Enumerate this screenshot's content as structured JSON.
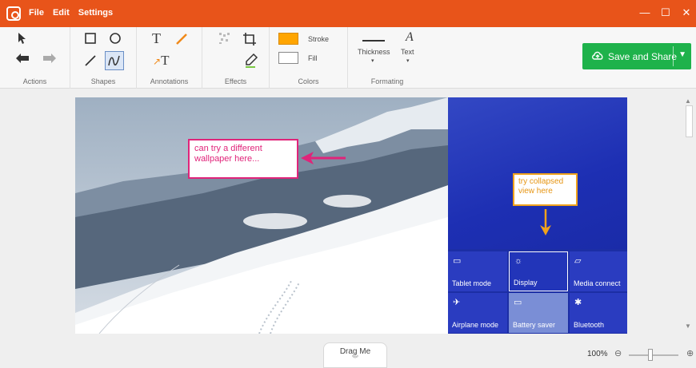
{
  "menu": {
    "file": "File",
    "edit": "Edit",
    "settings": "Settings"
  },
  "window_controls": {
    "minimize": "—",
    "maximize": "☐",
    "close": "✕"
  },
  "ribbon": {
    "groups": {
      "actions": "Actions",
      "shapes": "Shapes",
      "annotations": "Annotations",
      "effects": "Effects",
      "colors": "Colors",
      "formating": "Formating"
    },
    "stroke_label": "Stroke",
    "fill_label": "Fill",
    "thickness_label": "Thickness",
    "text_label": "Text",
    "stroke_color": "#ffa500",
    "fill_color": "#ffffff"
  },
  "save_button": {
    "label": "Save and Share"
  },
  "canvas": {
    "callout_pink": "can try a different wallpaper here...",
    "callout_orange": "try collapsed view here",
    "tiles": [
      {
        "label": "Tablet mode",
        "icon": "tablet-icon"
      },
      {
        "label": "Display",
        "icon": "brightness-icon"
      },
      {
        "label": "Media connect",
        "icon": "cast-icon"
      },
      {
        "label": "Airplane mode",
        "icon": "airplane-icon"
      },
      {
        "label": "Battery saver",
        "icon": "battery-icon"
      },
      {
        "label": "Bluetooth",
        "icon": "bluetooth-icon"
      }
    ]
  },
  "bottom": {
    "drag_label": "Drag Me",
    "zoom_level": "100%"
  },
  "colors": {
    "title_bar": "#e8541a",
    "accent_green": "#1eb24b",
    "callout_pink": "#e0247a",
    "callout_orange": "#f0a21c",
    "panel_blue": "#1c2ea5"
  }
}
